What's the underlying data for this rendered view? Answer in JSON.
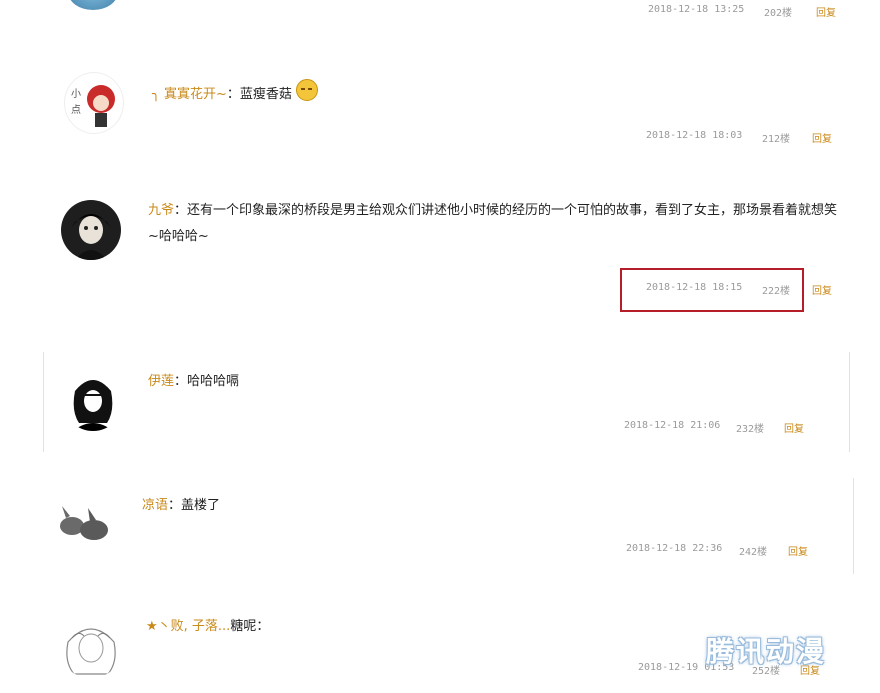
{
  "comments": [
    {
      "user": "",
      "text": "",
      "time": "2018-12-18 13:25",
      "floor": "202楼",
      "reply": "回复"
    },
    {
      "user": "╮ 寘寘花开~",
      "sep": "：",
      "text": "蓝瘦香菇",
      "time": "2018-12-18 18:03",
      "floor": "212楼",
      "reply": "回复",
      "emoji": "smile-emoji-icon"
    },
    {
      "user": "九爷",
      "sep": "：",
      "text": "还有一个印象最深的桥段是男主给观众们讲述他小时候的经历的一个可怕的故事，看到了女主，那场景看着就想笑~哈哈哈~",
      "time": "2018-12-18 18:15",
      "floor": "222楼",
      "reply": "回复"
    },
    {
      "user": "伊莲",
      "sep": "：",
      "text": "哈哈哈嗝",
      "time": "2018-12-18 21:06",
      "floor": "232楼",
      "reply": "回复"
    },
    {
      "user": "凉语",
      "sep": "：",
      "text": "盖楼了",
      "time": "2018-12-18 22:36",
      "floor": "242楼",
      "reply": "回复"
    },
    {
      "user": "★丶败, 子落...",
      "sep": "",
      "text": "糖呢：",
      "time": "2018-12-19 01:53",
      "floor": "252楼",
      "reply": "回复"
    }
  ],
  "watermark": "腾讯动漫",
  "colors": {
    "username": "#c98a1a",
    "highlight": "#b51e28",
    "meta": "#9a9a9a"
  }
}
